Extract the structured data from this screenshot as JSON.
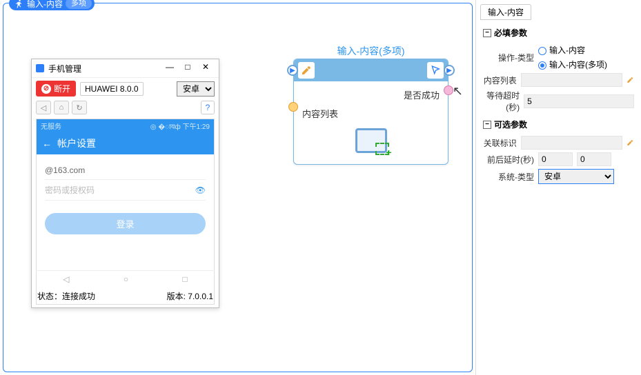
{
  "header": {
    "title": "输入-内容",
    "pill": "多项"
  },
  "phone_manager": {
    "title": "手机管理",
    "disconnect": "断开",
    "device": "HUAWEI 8.0.0",
    "os_options": [
      "安卓"
    ],
    "os_selected": "安卓",
    "status_label": "状态：",
    "status_value": "连接成功",
    "version_label": "版本: ",
    "version_value": "7.0.0.1",
    "phone": {
      "status_left": "无服务",
      "status_right": "下午1:29",
      "header": "帐户设置",
      "email": "@163.com",
      "password_placeholder": "密码或授权码",
      "login": "登录"
    }
  },
  "node": {
    "title": "输入-内容(多项)",
    "success": "是否成功",
    "list": "内容列表"
  },
  "side": {
    "tab": "输入-内容",
    "required": "必填参数",
    "optional": "可选参数",
    "op_type_label": "操作-类型",
    "op_type_opt1": "输入-内容",
    "op_type_opt2": "输入-内容(多项)",
    "content_list": "内容列表",
    "wait_timeout_label": "等待超时(秒)",
    "wait_timeout_value": "5",
    "assoc_label": "关联标识",
    "delay_label": "前后延时(秒)",
    "delay_before": "0",
    "delay_after": "0",
    "system_label": "系统-类型",
    "system_value": "安卓"
  }
}
